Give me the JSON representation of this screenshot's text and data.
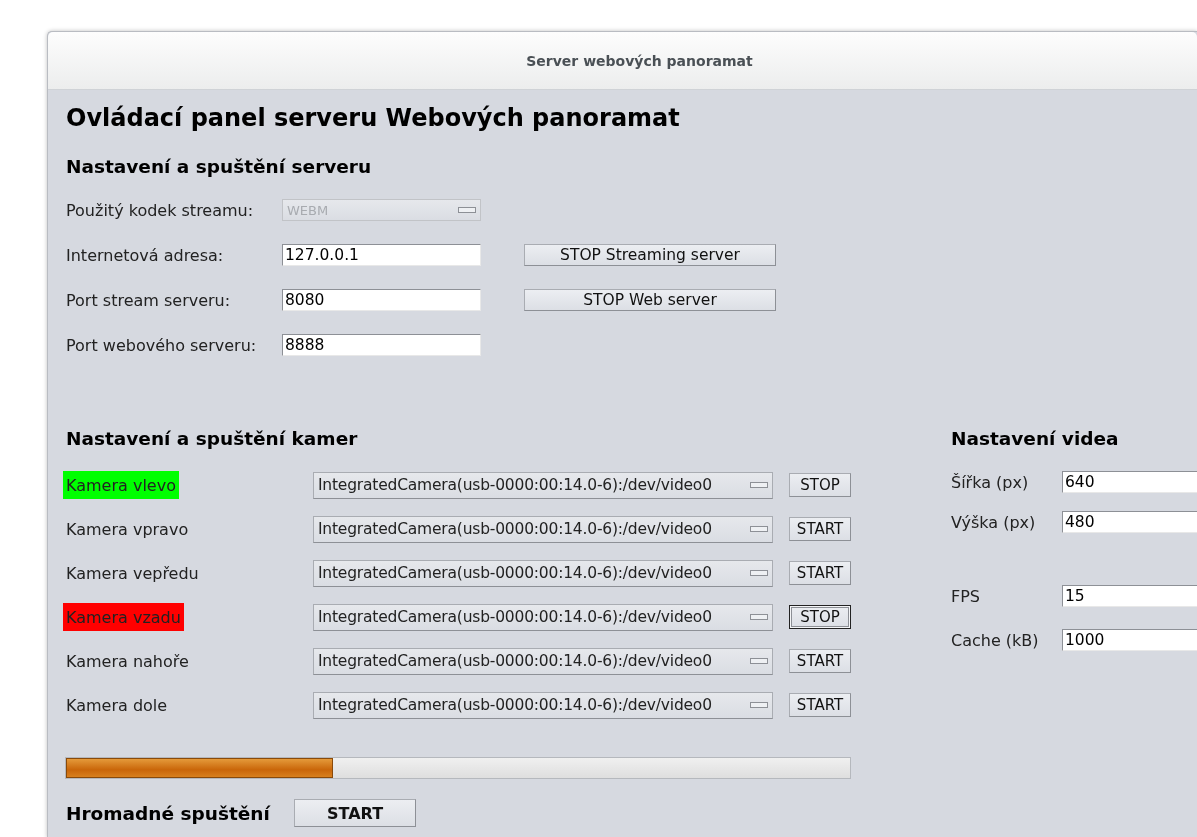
{
  "window": {
    "title": "Server webových panoramat"
  },
  "heading": "Ovládací panel serveru Webových panoramat",
  "server": {
    "title": "Nastavení a spuštění serveru",
    "rows": [
      {
        "label": "Použitý kodek streamu:",
        "kind": "combo",
        "value": "WEBM",
        "disabled": true
      },
      {
        "label": "Internetová adresa:",
        "kind": "text",
        "value": "127.0.0.1",
        "button": "STOP Streaming server"
      },
      {
        "label": "Port stream serveru:",
        "kind": "text",
        "value": "8080",
        "button": "STOP Web server"
      },
      {
        "label": "Port webového serveru:",
        "kind": "text",
        "value": "8888"
      }
    ]
  },
  "cameras": {
    "title": "Nastavení a spuštění kamer",
    "rows": [
      {
        "label": "Kamera vlevo",
        "color": "#00ff00",
        "device": "IntegratedCamera(usb-0000:00:14.0-6):/dev/video0",
        "button": "STOP",
        "focused": false
      },
      {
        "label": "Kamera vpravo",
        "device": "IntegratedCamera(usb-0000:00:14.0-6):/dev/video0",
        "button": "START",
        "focused": false
      },
      {
        "label": "Kamera vepředu",
        "device": "IntegratedCamera(usb-0000:00:14.0-6):/dev/video0",
        "button": "START",
        "focused": false
      },
      {
        "label": "Kamera vzadu",
        "color": "#ff0000",
        "device": "IntegratedCamera(usb-0000:00:14.0-6):/dev/video0",
        "button": "STOP",
        "focused": true
      },
      {
        "label": "Kamera nahoře",
        "device": "IntegratedCamera(usb-0000:00:14.0-6):/dev/video0",
        "button": "START",
        "focused": false
      },
      {
        "label": "Kamera dole",
        "device": "IntegratedCamera(usb-0000:00:14.0-6):/dev/video0",
        "button": "START",
        "focused": false
      }
    ],
    "progress": {
      "level": 0.34
    },
    "bulk": {
      "label": "Hromadné spuštění",
      "button": "START"
    }
  },
  "video": {
    "title": "Nastavení videa",
    "groups": [
      {
        "fields": [
          {
            "label": "Šířka (px)",
            "value": "640"
          },
          {
            "label": "Výška (px)",
            "value": "480"
          }
        ]
      },
      {
        "fields": [
          {
            "label": "FPS",
            "value": "15"
          },
          {
            "label": "Cache (kB)",
            "value": "1000"
          }
        ]
      }
    ]
  }
}
